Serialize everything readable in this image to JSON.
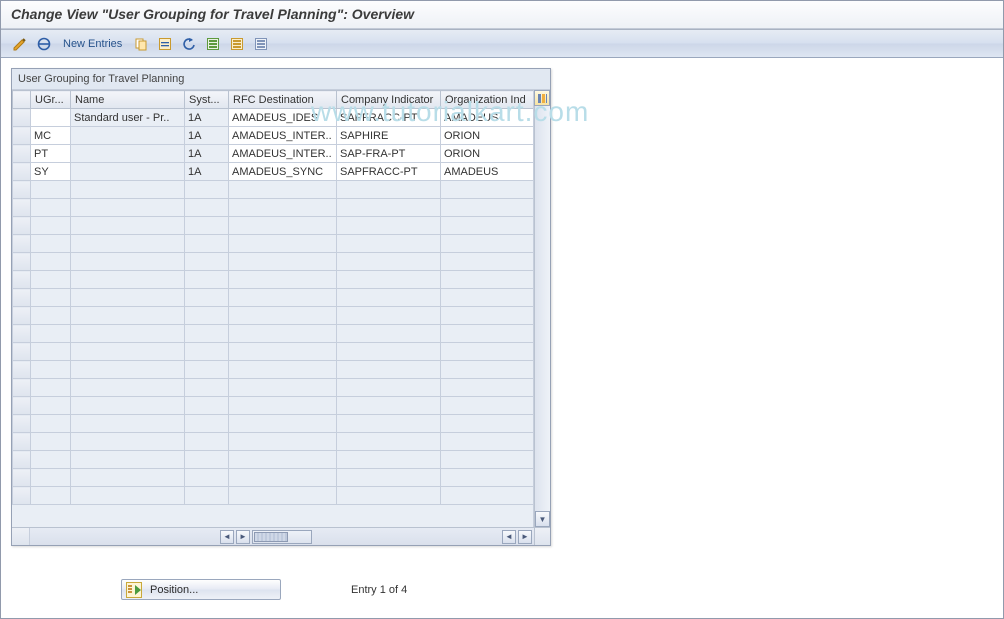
{
  "title": "Change View \"User Grouping for Travel Planning\": Overview",
  "watermark": "www.tutorialkart.com",
  "toolbar": {
    "new_entries": "New Entries"
  },
  "grid": {
    "title": "User Grouping for Travel Planning",
    "columns": [
      "UGr...",
      "Name",
      "Syst...",
      "RFC Destination",
      "Company Indicator",
      "Organization Ind"
    ],
    "rows": [
      {
        "ugr": "",
        "name": "Standard user - Pr..",
        "syst": "1A",
        "rfc": "AMADEUS_IDES",
        "company": "SAPFRACC-PT",
        "org": "AMADEUS"
      },
      {
        "ugr": "MC",
        "name": "",
        "syst": "1A",
        "rfc": "AMADEUS_INTER..",
        "company": "SAPHIRE",
        "org": "ORION"
      },
      {
        "ugr": "PT",
        "name": "",
        "syst": "1A",
        "rfc": "AMADEUS_INTER..",
        "company": "SAP-FRA-PT",
        "org": "ORION"
      },
      {
        "ugr": "SY",
        "name": "",
        "syst": "1A",
        "rfc": "AMADEUS_SYNC",
        "company": "SAPFRACC-PT",
        "org": "AMADEUS"
      }
    ]
  },
  "footer": {
    "position_btn": "Position...",
    "entry_text": "Entry 1 of 4"
  }
}
